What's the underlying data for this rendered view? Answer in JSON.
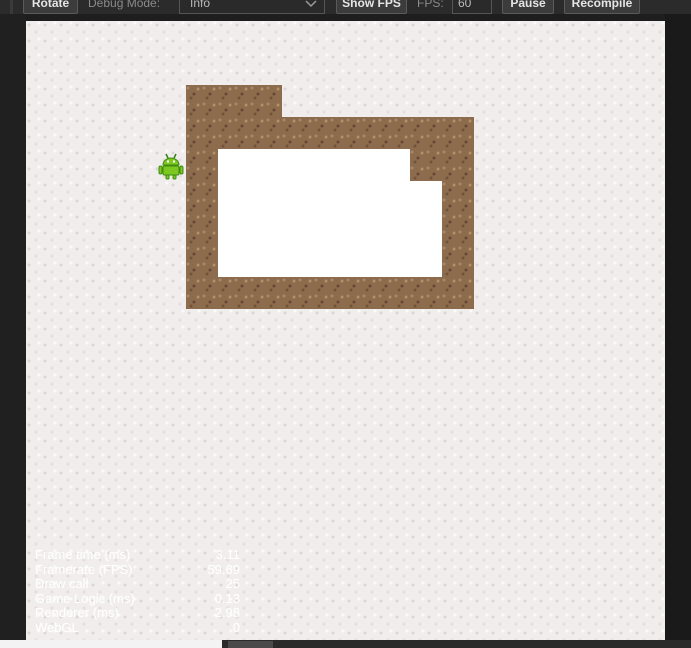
{
  "toolbar": {
    "rotate_label": "Rotate",
    "debug_mode_label": "Debug Mode:",
    "debug_mode_value": "Info",
    "show_fps_label": "Show FPS",
    "fps_label": "FPS:",
    "fps_value": "60",
    "pause_label": "Pause",
    "recompile_label": "Recompile"
  },
  "game": {
    "player_icon": "android-robot-icon",
    "floor_color": "#f1eded",
    "wall_color": "#8d6b4d"
  },
  "stats": [
    {
      "label": "Frame time (ms)",
      "value": "3.11"
    },
    {
      "label": "Framerate (FPS)",
      "value": "59.69"
    },
    {
      "label": "Draw call",
      "value": "25"
    },
    {
      "label": "Game Logic (ms)",
      "value": "0.13"
    },
    {
      "label": "Renderer (ms)",
      "value": "2.98"
    },
    {
      "label": "WebGL",
      "value": "0"
    }
  ]
}
